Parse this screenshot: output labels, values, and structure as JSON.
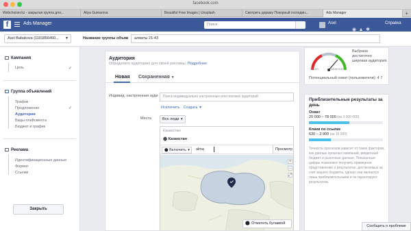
{
  "browser": {
    "url": "facebook.com",
    "tabs": [
      "Webchoiser.kz - закрытая группа для...",
      "Aliya Gumarova",
      "Beautiful Free Images | Unsplash",
      "Смотреть дораму Покорный господин...",
      "Ads Manager"
    ]
  },
  "fb": {
    "logo": "f",
    "title": "Ads Manager",
    "search_placeholder": "Поиск",
    "user": "Asel",
    "help": "Справка"
  },
  "subbar": {
    "account": "Asel Babakova (1101856460...",
    "adset_label": "Название группы объяв",
    "adset_name": "алматы 21-43"
  },
  "sidebar": {
    "campaign": "Кампания",
    "campaign_items": [
      "Цель"
    ],
    "adset": "Группа объявлений",
    "adset_items": [
      "Трафик",
      "Предложение",
      "Аудитория",
      "Виды плейсмента",
      "Бюджет и график"
    ],
    "ad": "Реклама",
    "ad_items": [
      "Идентификационные данные",
      "Формат",
      "Ссылки"
    ],
    "close_label": "Закрыть"
  },
  "audience": {
    "title": "Аудитория",
    "subtitle": "Определите аудиторию для своей рекламы.",
    "more_link": "Подробнее",
    "tab_new": "Новая",
    "tab_saved": "Сохраненная",
    "custom_label": "Индивид. настроенная ауди",
    "custom_placeholder": "Поиск индивидуально настроенных или похожих аудиторий",
    "exclude_link": "Исключить",
    "create_link": "Создать",
    "places_label": "Места",
    "places_select": "Все люди",
    "loc_header": "Казахстан",
    "loc_item": "Казахстан",
    "include_label": "Включить",
    "loc_input": "alma",
    "preview_label": "Просмотр",
    "drop_pin_label": "Отметить булавкой"
  },
  "right": {
    "gauge_text": "Выбрана достаточно широкая аудитория.",
    "gauge_narrow": "Узкая",
    "gauge_wide": "Широкая",
    "potential_reach": "Потенциальный охват (пользователи): 4 7",
    "results_title": "Приблизительные результаты за день",
    "reach_label": "Охват",
    "reach_value": "20 000 – 78 000",
    "reach_total": "(из 3 000 000)",
    "reach_fraction": 0.55,
    "clicks_label": "Клики по ссылке",
    "clicks_value": "630 – 3 900",
    "clicks_total": "(из 16 000)",
    "clicks_fraction": 0.3,
    "note": "Точность прогнозов зависит от таких факторов, как данные прошлых кампаний, введенный бюджет и рыночные данные. Показанные цифры позволяют получить примерное представление о результатах, достигаемых за счет вашего бюджета, однако они являются лишь приблизительными и не гарантируют результатов."
  },
  "report_problem": "Сообщить о проблеме",
  "colors": {
    "fb_blue": "#3b5998",
    "accent": "#4267b2",
    "bar": "#4ac1e8"
  }
}
